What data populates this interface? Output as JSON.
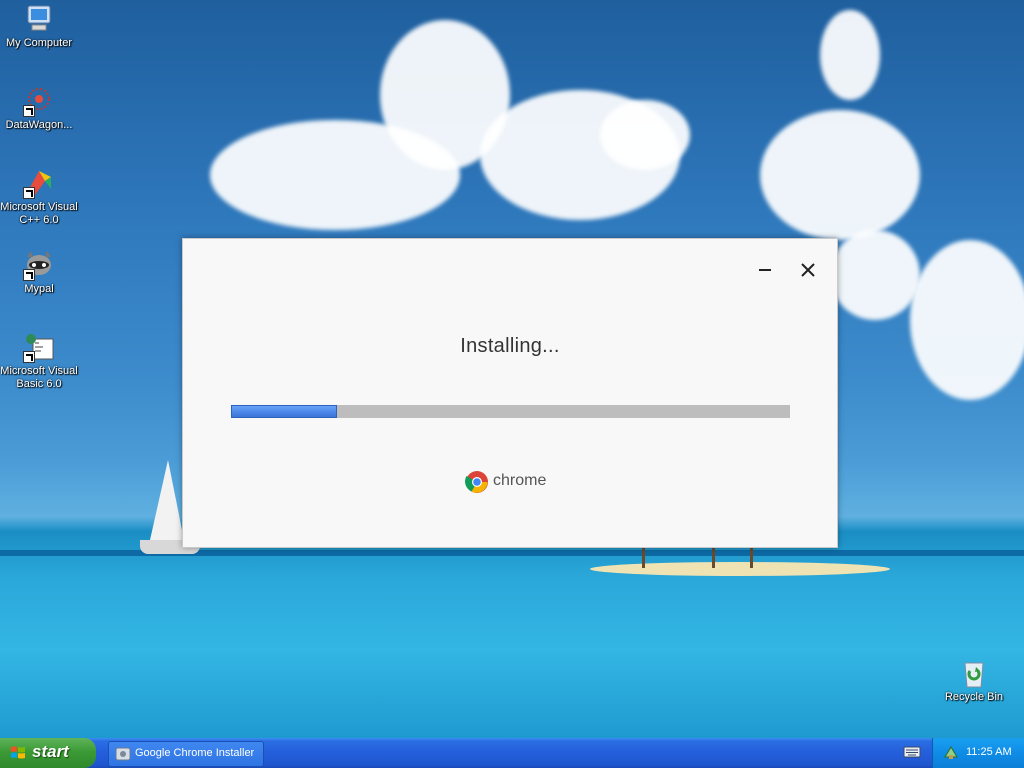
{
  "desktop": {
    "icons": [
      {
        "label": "My Computer",
        "icon": "my-computer-icon"
      },
      {
        "label": "DataWagon...",
        "icon": "datawagon-icon"
      },
      {
        "label": "Microsoft Visual C++ 6.0",
        "icon": "visual-cpp-icon"
      },
      {
        "label": "Mypal",
        "icon": "mypal-icon"
      },
      {
        "label": "Microsoft Visual Basic 6.0",
        "icon": "visual-basic-icon"
      },
      {
        "label": "Recycle Bin",
        "icon": "recycle-bin-icon"
      }
    ]
  },
  "installer": {
    "status": "Installing...",
    "progress_fraction": 0.19,
    "brand_name": "chrome",
    "colors": {
      "progress_fill": "#4a86e8",
      "progress_track": "#bdbdbd"
    }
  },
  "taskbar": {
    "start_label": "start",
    "window_button": "Google Chrome Installer",
    "clock": "11:25 AM"
  }
}
